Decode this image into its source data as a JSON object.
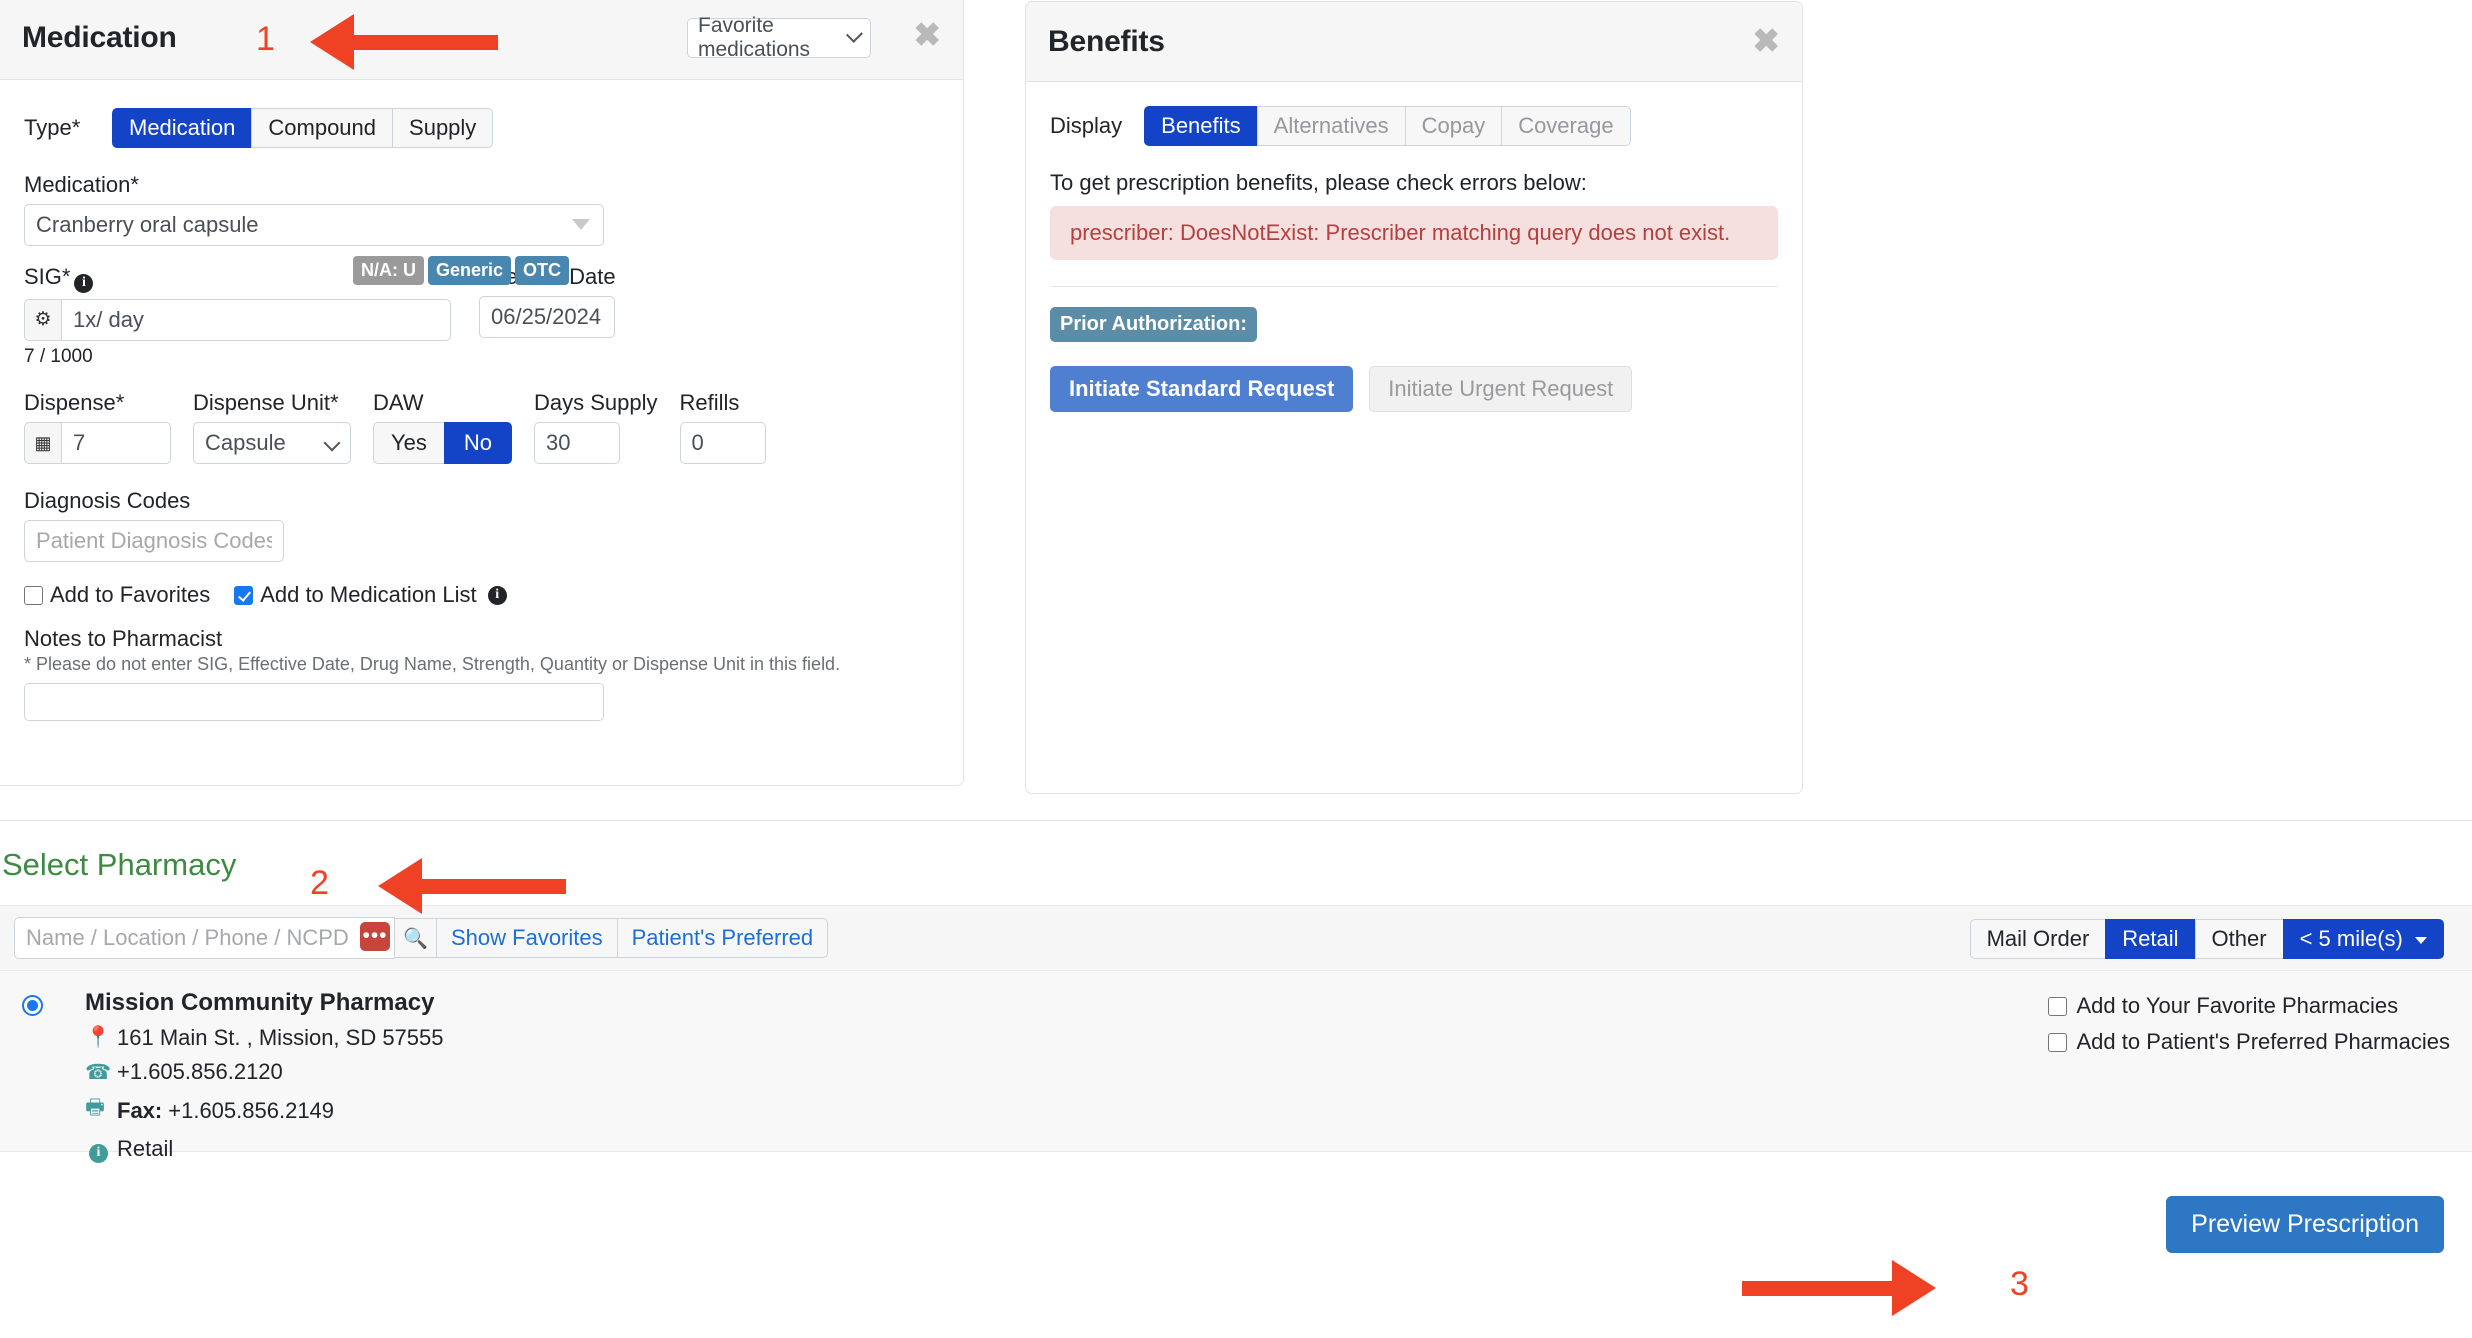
{
  "medication_panel": {
    "title": "Medication",
    "favorite_select_value": "Favorite medications",
    "close_label": "✖",
    "type_label": "Type*",
    "type_options": [
      "Medication",
      "Compound",
      "Supply"
    ],
    "type_selected": "Medication",
    "medication_label": "Medication*",
    "medication_value": "Cranberry oral capsule",
    "badges": [
      {
        "text": "N/A: U",
        "color": "#9a9a9a"
      },
      {
        "text": "Generic",
        "color": "#4a87ae"
      },
      {
        "text": "OTC",
        "color": "#4a87ae"
      }
    ],
    "sig_label": "SIG*",
    "sig_value": "1x/ day",
    "sig_counter": "7 / 1000",
    "effective_date_label": "Effective Date",
    "effective_date_value": "06/25/2024",
    "dispense_label": "Dispense*",
    "dispense_value": "7",
    "dispense_unit_label": "Dispense Unit*",
    "dispense_unit_value": "Capsule",
    "daw_label": "DAW",
    "daw_options": [
      "Yes",
      "No"
    ],
    "daw_selected": "No",
    "days_supply_label": "Days Supply",
    "days_supply_value": "30",
    "refills_label": "Refills",
    "refills_value": "0",
    "diagnosis_label": "Diagnosis Codes",
    "diagnosis_placeholder": "Patient Diagnosis Codes",
    "add_favorites_label": "Add to Favorites",
    "add_favorites_checked": false,
    "add_med_list_label": "Add to Medication List",
    "add_med_list_checked": true,
    "notes_label": "Notes to Pharmacist",
    "notes_hint": "* Please do not enter SIG, Effective Date, Drug Name, Strength, Quantity or Dispense Unit in this field.",
    "notes_value": ""
  },
  "benefits_panel": {
    "title": "Benefits",
    "close_label": "✖",
    "display_label": "Display",
    "tabs": [
      "Benefits",
      "Alternatives",
      "Copay",
      "Coverage"
    ],
    "tab_selected": "Benefits",
    "message": "To get prescription benefits, please check errors below:",
    "error_text": "prescriber: DoesNotExist: Prescriber matching query does not exist.",
    "prior_auth_label": "Prior Authorization:",
    "standard_request_label": "Initiate Standard Request",
    "urgent_request_label": "Initiate Urgent Request"
  },
  "pharmacy_section": {
    "title": "Select Pharmacy",
    "search_placeholder": "Name / Location / Phone / NCPDP ID",
    "search_value": "",
    "dots_label": "•••",
    "search_icon": "search-icon",
    "show_favorites_label": "Show Favorites",
    "patients_preferred_label": "Patient's Preferred",
    "filters": [
      "Mail Order",
      "Retail",
      "Other"
    ],
    "filter_selected": "Retail",
    "distance_label": "< 5 mile(s)",
    "result": {
      "name": "Mission Community Pharmacy",
      "address": "161 Main St. , Mission, SD 57555",
      "phone": "+1.605.856.2120",
      "fax_label": "Fax:",
      "fax": "+1.605.856.2149",
      "type": "Retail",
      "selected": true,
      "add_favorite_label": "Add to Your Favorite Pharmacies",
      "add_favorite_checked": false,
      "add_preferred_label": "Add to Patient's Preferred Pharmacies",
      "add_preferred_checked": false
    },
    "preview_button_label": "Preview Prescription"
  },
  "annotations": {
    "marker_1": "1",
    "marker_2": "2",
    "marker_3": "3",
    "color": "#ef4123"
  }
}
